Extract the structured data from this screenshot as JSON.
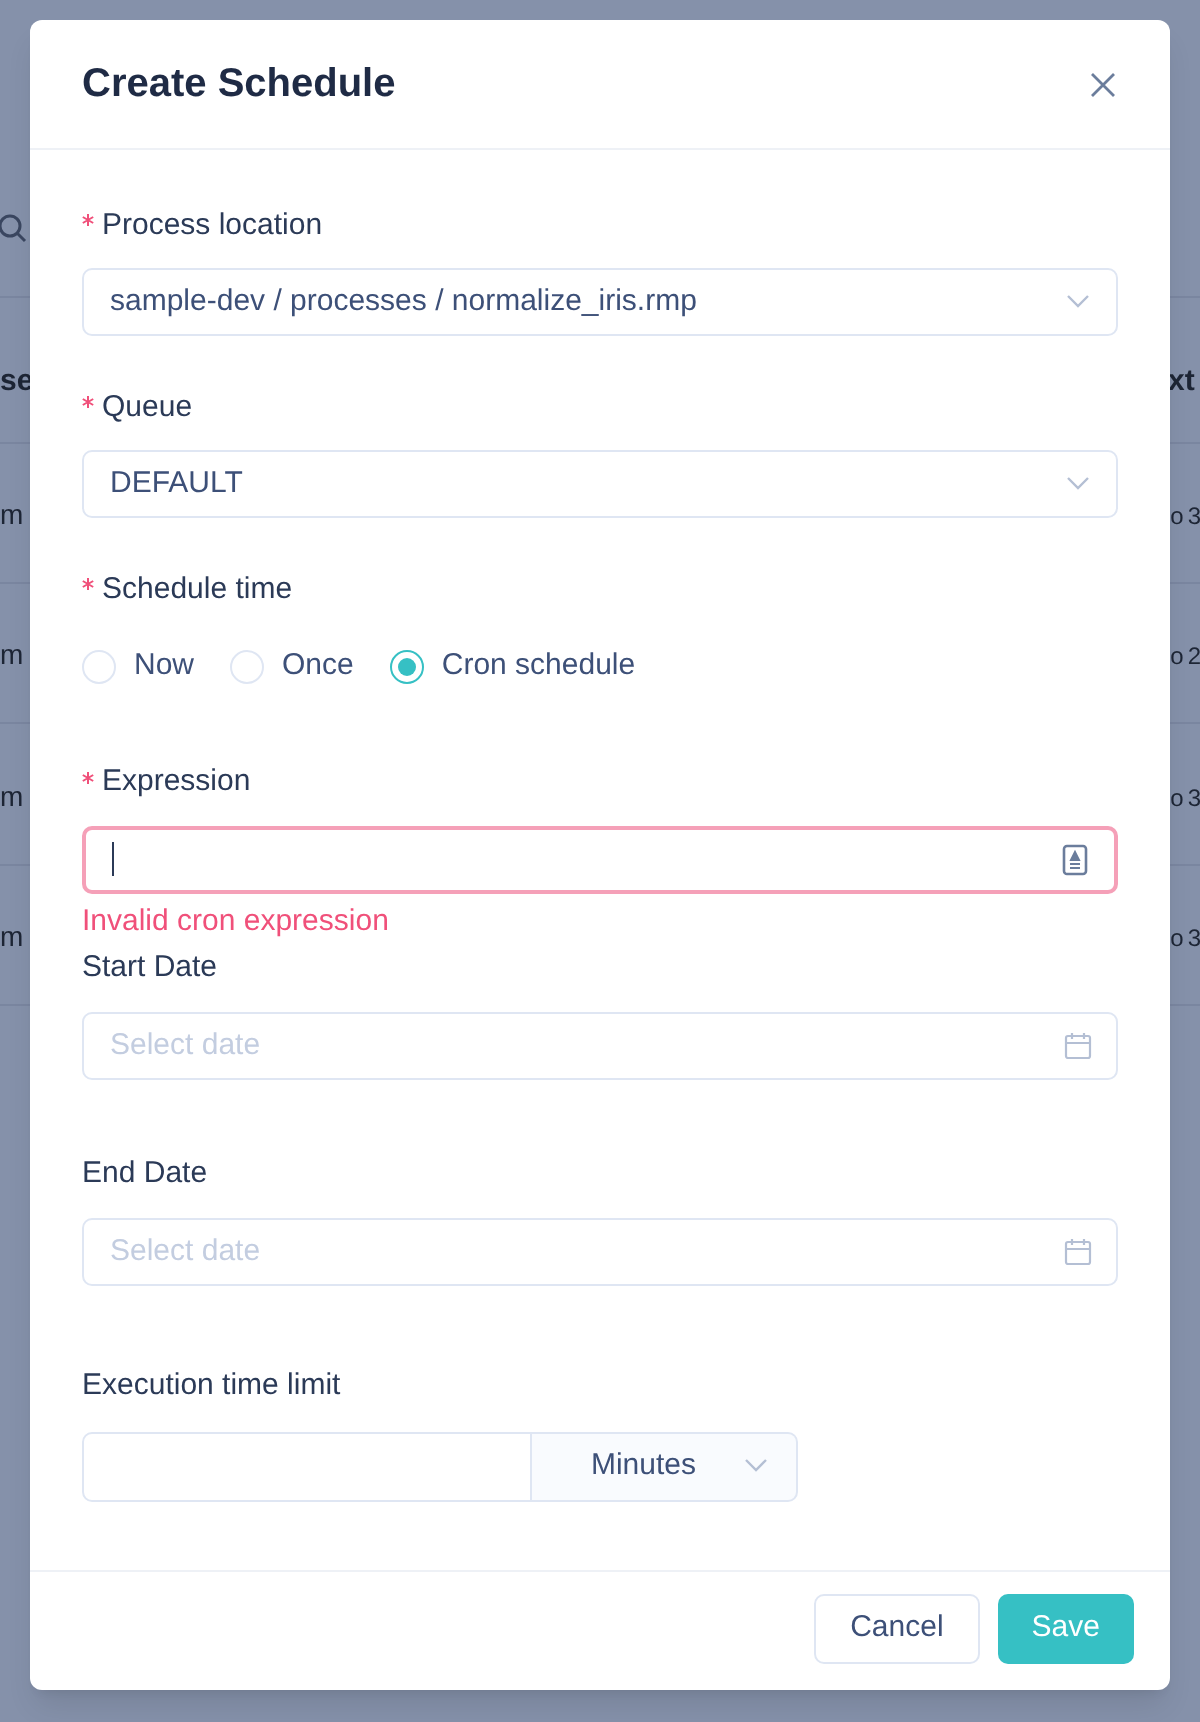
{
  "background_table": {
    "header": {
      "column_1": "se",
      "column_2": "xt"
    },
    "rows": [
      {
        "column_1": "m",
        "column_2": "o 3"
      },
      {
        "column_1": "m",
        "column_2": "o 2"
      },
      {
        "column_1": "m",
        "column_2": "o 3"
      },
      {
        "column_1": "m",
        "column_2": "o 3"
      }
    ]
  },
  "dialog": {
    "title": "Create Schedule",
    "process_location": {
      "label": "Process location",
      "required": true,
      "value": "sample-dev / processes / normalize_iris.rmp"
    },
    "queue": {
      "label": "Queue",
      "required": true,
      "value": "DEFAULT"
    },
    "schedule_time": {
      "label": "Schedule time",
      "required": true,
      "options": [
        {
          "label": "Now",
          "selected": false
        },
        {
          "label": "Once",
          "selected": false
        },
        {
          "label": "Cron schedule",
          "selected": true
        }
      ]
    },
    "expression": {
      "label": "Expression",
      "required": true,
      "invalid": true,
      "error": "Invalid cron expression"
    },
    "start_date": {
      "label": "Start Date",
      "required": false,
      "placeholder": "Select date"
    },
    "end_date": {
      "label": "End Date",
      "required": false,
      "placeholder": "Select date"
    },
    "execution_time_limit": {
      "label": "Execution time limit",
      "unit": "Minutes"
    },
    "buttons": [
      {
        "label": "Cancel",
        "kind": "secondary"
      },
      {
        "label": "Save",
        "kind": "primary"
      }
    ]
  }
}
